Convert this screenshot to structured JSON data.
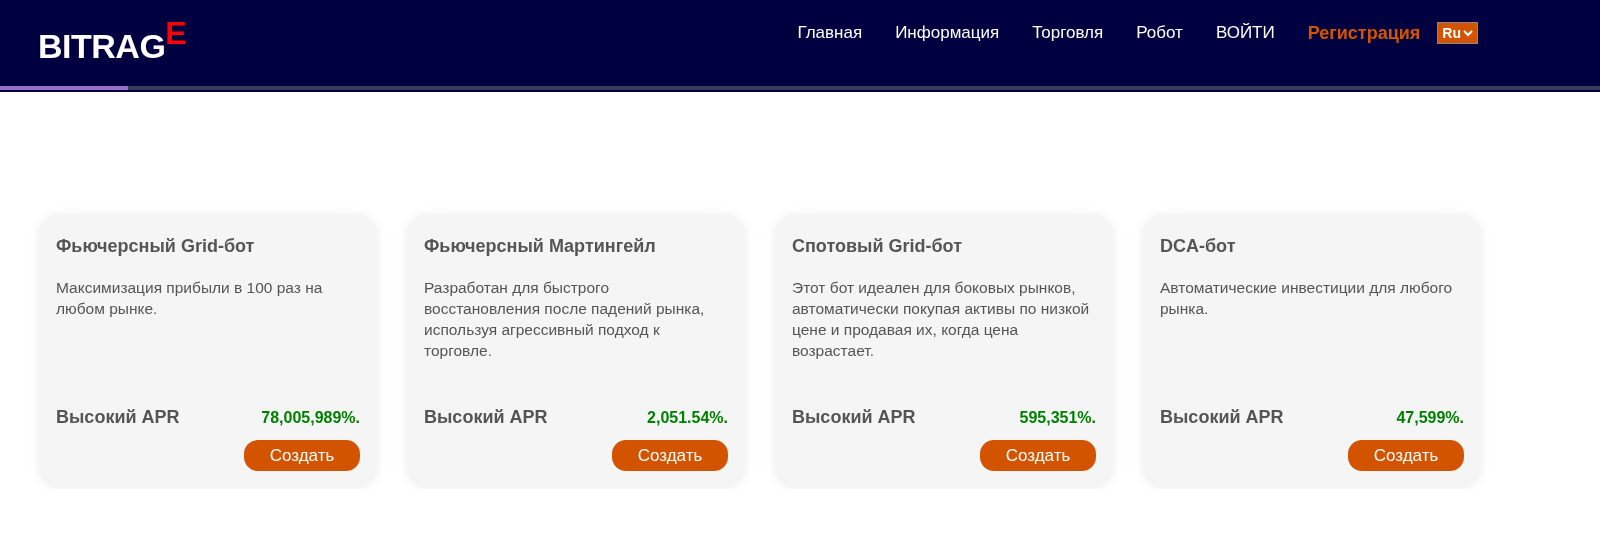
{
  "header": {
    "logo": {
      "text": "BITRAG",
      "accent": "E"
    },
    "nav": [
      {
        "label": "Главная",
        "highlighted": false
      },
      {
        "label": "Информация",
        "highlighted": false
      },
      {
        "label": "Торговля",
        "highlighted": false
      },
      {
        "label": "Робот",
        "highlighted": false
      },
      {
        "label": "ВОЙТИ",
        "highlighted": false
      },
      {
        "label": "Регистрация",
        "highlighted": true
      }
    ],
    "language": "Ru",
    "scroll_progress": {
      "level": 0.08
    }
  },
  "bots": [
    {
      "title": "Фьючерсный Grid-бот",
      "description": "Максимизация прибыли в 100 раз на любом рынке.",
      "apr_label": "Высокий APR",
      "apr_value": "78,005,989%.",
      "button": "Создать"
    },
    {
      "title": "Фьючерсный Мартингейл",
      "description": "Разработан для быстрого восстановления после падений рынка, используя агрессивный подход к торговле.",
      "apr_label": "Высокий APR",
      "apr_value": "2,051.54%.",
      "button": "Создать"
    },
    {
      "title": "Спотовый Grid-бот",
      "description": "Этот бот идеален для боковых рынков, автоматически покупая активы по низкой цене и продавая их, когда цена возрастает.",
      "apr_label": "Высокий APR",
      "apr_value": "595,351%.",
      "button": "Создать"
    },
    {
      "title": "DCA-бот",
      "description": "Автоматические инвестиции для любого рынка.",
      "apr_label": "Высокий APR",
      "apr_value": "47,599%.",
      "button": "Создать"
    }
  ]
}
